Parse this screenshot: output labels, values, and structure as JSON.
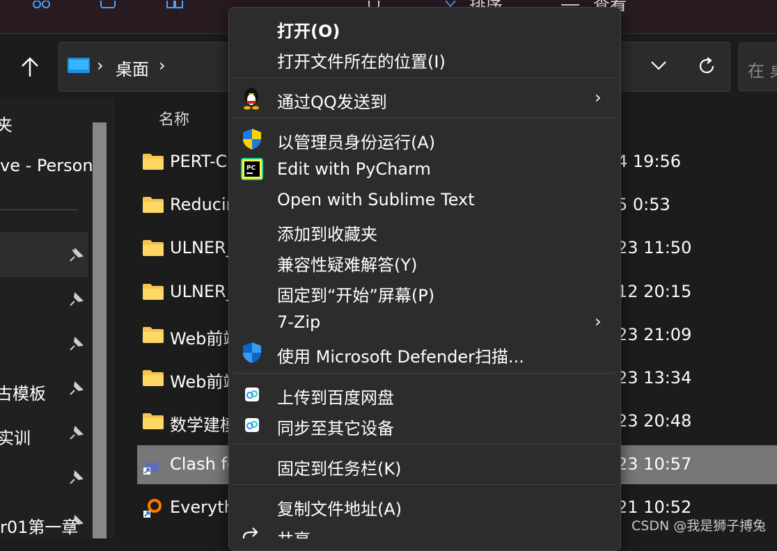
{
  "toolbar": {
    "sort_label": "排序",
    "view_label": "查看"
  },
  "address_bar": {
    "crumb": "桌面",
    "search_placeholder": "在 桌"
  },
  "nav": {
    "items": [
      "夹",
      "ve - Person",
      "古模板",
      "实训",
      "r01第一章"
    ]
  },
  "file_list": {
    "column_name": "名称",
    "rows": [
      {
        "name": "PERT-C",
        "date": "4 19:56",
        "type": "folder"
      },
      {
        "name": "Reducir",
        "date": "5 0:53",
        "type": "folder"
      },
      {
        "name": "ULNER_",
        "date": "23 11:50",
        "type": "folder"
      },
      {
        "name": "ULNER_",
        "date": "12 20:15",
        "type": "folder"
      },
      {
        "name": "Web前端",
        "date": "23 21:09",
        "type": "folder"
      },
      {
        "name": "Web前端",
        "date": "23 13:34",
        "type": "folder"
      },
      {
        "name": "数学建模",
        "date": "23 20:48",
        "type": "folder"
      },
      {
        "name": "Clash fo",
        "date": "23 10:57",
        "type": "shortcut-clash"
      },
      {
        "name": "Everyth",
        "date": "21 10:52",
        "type": "shortcut-everything"
      }
    ]
  },
  "context_menu": {
    "items": [
      {
        "label": "打开(O)",
        "bold": true
      },
      {
        "label": "打开文件所在的位置(I)"
      },
      {
        "label": "通过QQ发送到",
        "icon": "qq-penguin-icon",
        "submenu": true
      },
      {
        "label": "以管理员身份运行(A)",
        "icon": "uac-shield-icon"
      },
      {
        "label": "Edit with PyCharm",
        "icon": "pycharm-icon"
      },
      {
        "label": "Open with Sublime Text"
      },
      {
        "label": "添加到收藏夹"
      },
      {
        "label": "兼容性疑难解答(Y)"
      },
      {
        "label": "固定到“开始”屏幕(P)"
      },
      {
        "label": "7-Zip",
        "submenu": true
      },
      {
        "label": "使用 Microsoft Defender扫描...",
        "icon": "defender-shield-icon"
      },
      {
        "label": "上传到百度网盘",
        "icon": "baidu-netdisk-icon"
      },
      {
        "label": "同步至其它设备",
        "icon": "baidu-netdisk-icon"
      },
      {
        "label": "固定到任务栏(K)"
      },
      {
        "label": "复制文件地址(A)"
      },
      {
        "label": "共享",
        "icon": "share-icon"
      }
    ],
    "submenu_arrow": "›"
  },
  "watermark": "CSDN @我是狮子搏兔",
  "colors": {
    "window_bg": "#1c1c1c",
    "menu_bg": "#2c2c2c",
    "toolbar_bg": "#281b22",
    "selection": "#777777",
    "folder": "#f5c451"
  }
}
